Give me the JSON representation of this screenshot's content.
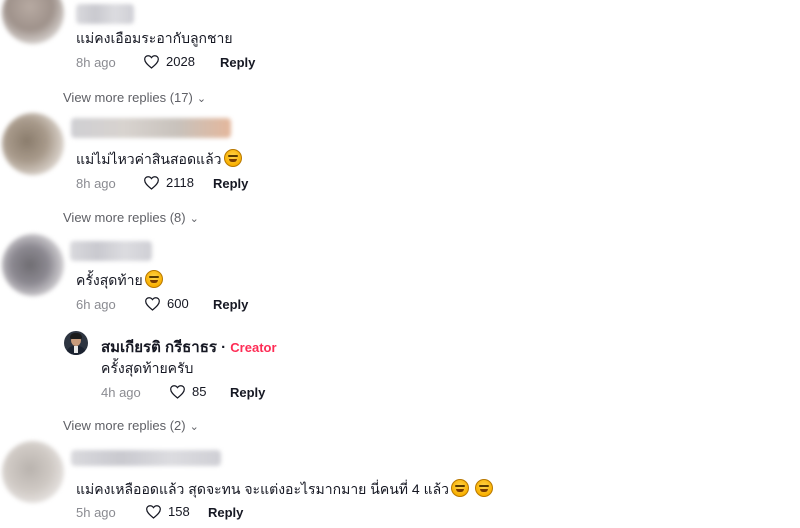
{
  "comments": [
    {
      "text": "แม่คงเอือมระอากับลูกชาย",
      "emoji_count": 0,
      "time": "8h ago",
      "likes": "2028",
      "reply_label": "Reply",
      "view_more": "View more replies (17)"
    },
    {
      "text": "แม่ไม่ไหวค่าสินสอดแล้ว",
      "emoji_count": 1,
      "time": "8h ago",
      "likes": "2118",
      "reply_label": "Reply",
      "view_more": "View more replies (8)"
    },
    {
      "text": "ครั้งสุดท้าย",
      "emoji_count": 1,
      "time": "6h ago",
      "likes": "600",
      "reply_label": "Reply",
      "reply": {
        "author": "สมเกียรติ กรีธาธร",
        "separator": "·",
        "badge": "Creator",
        "text": "ครั้งสุดท้ายครับ",
        "time": "4h ago",
        "likes": "85",
        "reply_label": "Reply"
      },
      "view_more": "View more replies (2)"
    },
    {
      "text": "แม่คงเหลืออดแล้ว สุดจะทน จะแต่งอะไรมากมาย นี่คนที่ 4 แล้ว",
      "emoji_count": 2,
      "time": "5h ago",
      "likes": "158",
      "reply_label": "Reply"
    }
  ],
  "icons": {
    "like": "heart-outline-icon",
    "expand": "chevron-down-icon"
  },
  "colors": {
    "creator_badge": "#fe2c55",
    "meta_text": "#8a8b91"
  }
}
